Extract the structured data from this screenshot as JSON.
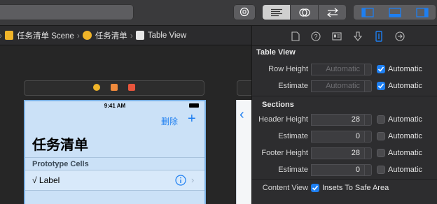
{
  "breadcrumb": {
    "items": [
      "任务清单 Scene",
      "任务清单",
      "Table View"
    ]
  },
  "phone": {
    "time": "9:41 AM",
    "edit_label": "删除",
    "add_label": "+",
    "title": "任务清单",
    "section_header": "Prototype Cells",
    "cell_label": "√ Label"
  },
  "inspector": {
    "table_view_header": "Table View",
    "rows": [
      {
        "label": "Row Height",
        "value": "Automatic",
        "check": "Automatic",
        "checked": true
      },
      {
        "label": "Estimate",
        "value": "Automatic",
        "check": "Automatic",
        "checked": true
      }
    ],
    "sections_header": "Sections",
    "section_rows": [
      {
        "label": "Header Height",
        "value": "28",
        "check": "Automatic",
        "checked": false
      },
      {
        "label": "Estimate",
        "value": "0",
        "check": "Automatic",
        "checked": false
      },
      {
        "label": "Footer Height",
        "value": "28",
        "check": "Automatic",
        "checked": false
      },
      {
        "label": "Estimate",
        "value": "0",
        "check": "Automatic",
        "checked": false
      }
    ],
    "content_view_label": "Content View",
    "content_view_check": "Insets To Safe Area",
    "content_view_checked": true
  },
  "colors": {
    "accent": "#1e7ff1",
    "phone_bg": "#cbe1f7",
    "phone_border": "#7bb0e3"
  }
}
